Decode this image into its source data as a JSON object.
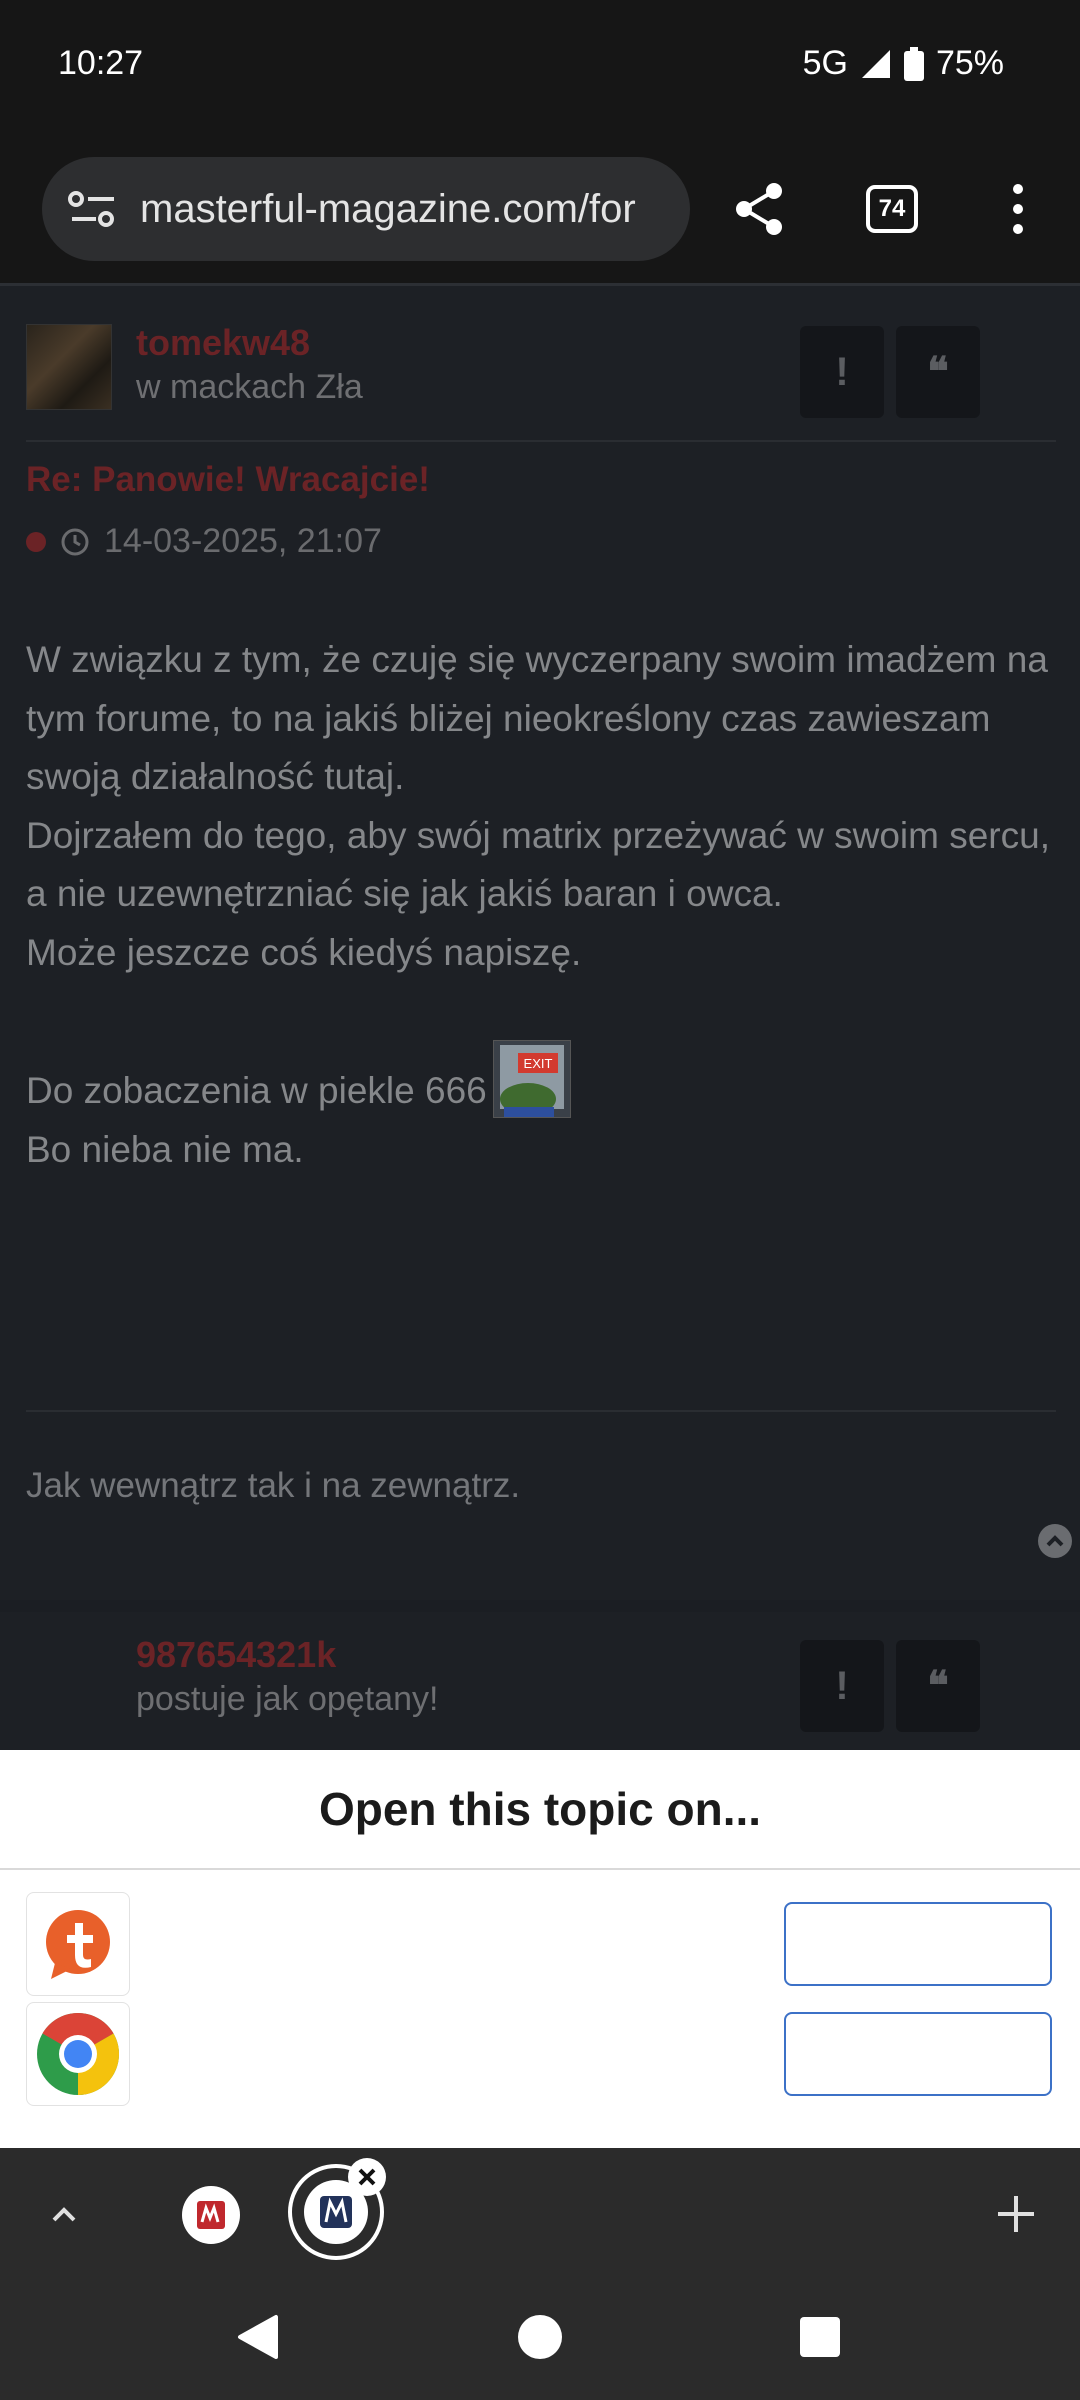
{
  "status_bar": {
    "time": "10:27",
    "network": "5G",
    "battery": "75%"
  },
  "browser": {
    "url": "masterful-magazine.com/for",
    "tab_count": "74",
    "icons": [
      "page-info-icon",
      "share-icon",
      "tab-switcher-icon",
      "more-vert-icon"
    ]
  },
  "post": {
    "username": "tomekw48",
    "user_title": "w mackach Zła",
    "subject": "Re: Panowie! Wracajcie!",
    "date": "14-03-2025, 21:07",
    "report_label": "!",
    "quote_label": "❝",
    "paragraphs": [
      "W związku z tym, że czuję się wyczerpany swoim imadżem na tym forume, to na jakiś bliżej nieokreślony czas zawieszam swoją działalność tutaj.",
      "Dojrzałem do tego, aby swój matrix przeżywać w swoim sercu, a nie uzewnętrzniać się jak jakiś baran i owca.",
      "Może jeszcze coś kiedyś napiszę.",
      "Do zobaczenia w piekle 666",
      "Bo nieba nie ma."
    ],
    "emoji_text": "EXIT",
    "signature": "Jak wewnątrz tak i na zewnątrz."
  },
  "next_post": {
    "username": "987654321k",
    "user_title": "postuje jak opętany!",
    "report_label": "!",
    "quote_label": "❝"
  },
  "sheet": {
    "title": "Open this topic on...",
    "apps": [
      {
        "icon": "tapatalk-icon",
        "button": ""
      },
      {
        "icon": "chrome-icon",
        "button": ""
      }
    ]
  },
  "colors": {
    "accent_username": "#6b2326",
    "sheet_button_border": "#3c71c7",
    "page_bg": "#1d2025"
  }
}
